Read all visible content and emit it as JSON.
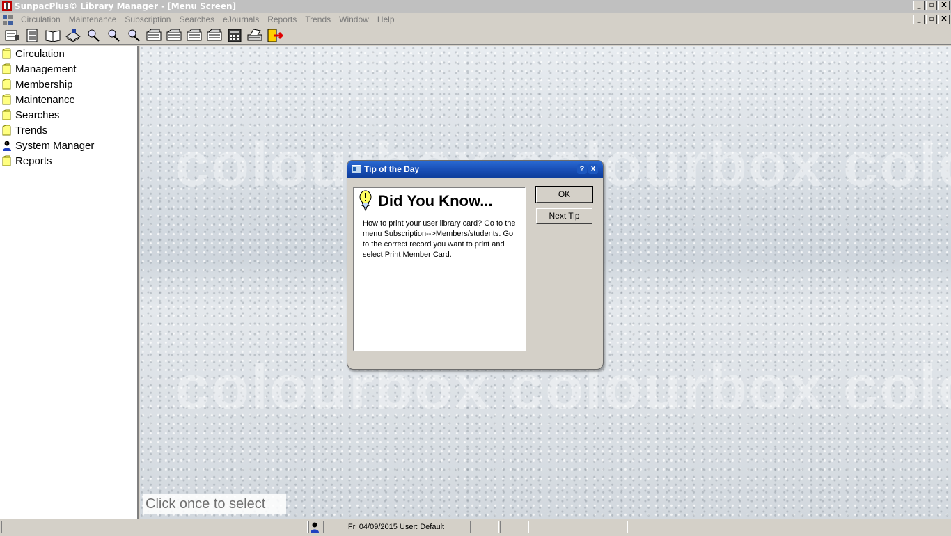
{
  "window": {
    "title": "SunpacPlus© Library Manager - [Menu Screen]",
    "controls": [
      "_",
      "▫",
      "X"
    ]
  },
  "menubar": {
    "items": [
      "Circulation",
      "Maintenance",
      "Subscription",
      "Searches",
      "eJournals",
      "Reports",
      "Trends",
      "Window",
      "Help"
    ]
  },
  "toolbar": {
    "buttons": [
      "circulation-icon",
      "returns-icon",
      "books-icon",
      "catalog-icon",
      "search-icon",
      "search2-icon",
      "search3-icon",
      "report1-icon",
      "report2-icon",
      "report3-icon",
      "report4-icon",
      "calculator-icon",
      "print-icon",
      "exit-icon"
    ]
  },
  "sidebar": {
    "items": [
      {
        "label": "Circulation",
        "icon": "folder-icon"
      },
      {
        "label": "Management",
        "icon": "folder-icon"
      },
      {
        "label": "Membership",
        "icon": "folder-icon"
      },
      {
        "label": "Maintenance",
        "icon": "folder-icon"
      },
      {
        "label": "Searches",
        "icon": "folder-icon"
      },
      {
        "label": "Trends",
        "icon": "folder-icon"
      },
      {
        "label": "System Manager",
        "icon": "user-icon"
      },
      {
        "label": "Reports",
        "icon": "folder-icon"
      }
    ]
  },
  "main": {
    "hint": "Click once to select",
    "watermark": "colourbox colourbox colo"
  },
  "dialog": {
    "title": "Tip of the Day",
    "help": "?",
    "close": "X",
    "heading": "Did You Know...",
    "tip": "How to print your user library card? Go to the menu Subscription-->Members/students. Go to the correct record you want to print and select Print Member Card.",
    "ok_label": "OK",
    "next_label": "Next Tip"
  },
  "statusbar": {
    "datetime_user": "Fri 04/09/2015 User: Default"
  },
  "colors": {
    "title_active": "#c0c0c0",
    "dialog_title": "#1a50b8",
    "menu_disabled": "#7a7a7a"
  }
}
